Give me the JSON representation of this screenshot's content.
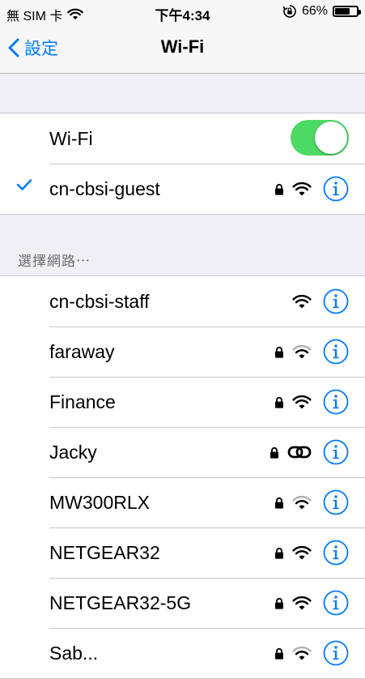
{
  "status": {
    "carrier": "無 SIM 卡",
    "time": "下午4:34",
    "battery": "66%",
    "battery_level": 0.66
  },
  "nav": {
    "back_label": "設定",
    "title": "Wi-Fi"
  },
  "wifi_toggle": {
    "label": "Wi-Fi",
    "on": true
  },
  "connected": {
    "name": "cn-cbsi-guest",
    "secured": true,
    "signal": "full"
  },
  "choose_header": "選擇網路⋯",
  "networks": [
    {
      "name": "cn-cbsi-staff",
      "secured": false,
      "signal": "full"
    },
    {
      "name": "faraway",
      "secured": true,
      "signal": "weak"
    },
    {
      "name": "Finance",
      "secured": true,
      "signal": "full"
    },
    {
      "name": "Jacky",
      "secured": true,
      "signal": "chain"
    },
    {
      "name": "MW300RLX",
      "secured": true,
      "signal": "weak"
    },
    {
      "name": "NETGEAR32",
      "secured": true,
      "signal": "full"
    },
    {
      "name": "NETGEAR32-5G",
      "secured": true,
      "signal": "full"
    },
    {
      "name": "Sab...",
      "secured": true,
      "signal": "weak"
    }
  ],
  "colors": {
    "accent": "#007aff",
    "toggle_on": "#4cd964",
    "background": "#efeff4"
  },
  "icons": {
    "wifi": "wifi-icon",
    "lock": "lock-icon",
    "info": "info-icon",
    "check": "checkmark-icon",
    "back": "chevron-left-icon",
    "chain": "link-icon"
  }
}
